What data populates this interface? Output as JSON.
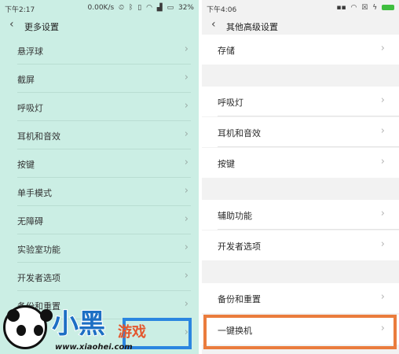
{
  "left": {
    "status": {
      "time": "下午2:17",
      "speed": "0.00K/s",
      "battery": "32%"
    },
    "header": {
      "back_icon": "‹",
      "title": "更多设置"
    },
    "items": [
      {
        "label": "悬浮球"
      },
      {
        "label": "截屏"
      },
      {
        "label": "呼吸灯"
      },
      {
        "label": "耳机和音效"
      },
      {
        "label": "按键"
      },
      {
        "label": "单手模式"
      },
      {
        "label": "无障碍"
      },
      {
        "label": "实验室功能"
      },
      {
        "label": "开发者选项"
      },
      {
        "label": "备份和重置"
      }
    ],
    "chevron": "›"
  },
  "right": {
    "status": {
      "time": "下午4:06"
    },
    "header": {
      "back_icon": "‹",
      "title": "其他高级设置"
    },
    "items": [
      {
        "label": "存储"
      },
      {
        "label": "呼吸灯"
      },
      {
        "label": "耳机和音效"
      },
      {
        "label": "按键"
      },
      {
        "label": "辅助功能"
      },
      {
        "label": "开发者选项"
      },
      {
        "label": "备份和重置"
      },
      {
        "label": "一键换机"
      }
    ],
    "chevron": "›"
  },
  "watermark": {
    "brand": "小黑",
    "brand2": "游戏",
    "site": "www.xiaohei.com"
  },
  "colors": {
    "left_bg": "#cbeee4",
    "right_bg": "#f2f2f2",
    "blue_highlight": "#2b86e0",
    "orange_highlight": "#ea7c3d"
  }
}
